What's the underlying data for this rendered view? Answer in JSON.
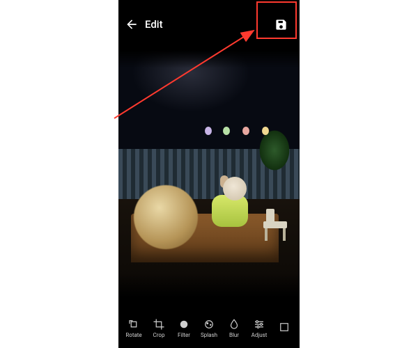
{
  "header": {
    "title": "Edit",
    "back_icon_name": "back-arrow-icon",
    "save_icon_name": "save-icon"
  },
  "tools": [
    {
      "key": "rotate",
      "label": "Rotate"
    },
    {
      "key": "crop",
      "label": "Crop"
    },
    {
      "key": "filter",
      "label": "Filter"
    },
    {
      "key": "splash",
      "label": "Splash"
    },
    {
      "key": "blur",
      "label": "Blur"
    },
    {
      "key": "adjust",
      "label": "Adjust"
    },
    {
      "key": "more",
      "label": ""
    }
  ],
  "annotation": {
    "type": "callout",
    "target": "save-button",
    "color": "#ff3a2f"
  }
}
